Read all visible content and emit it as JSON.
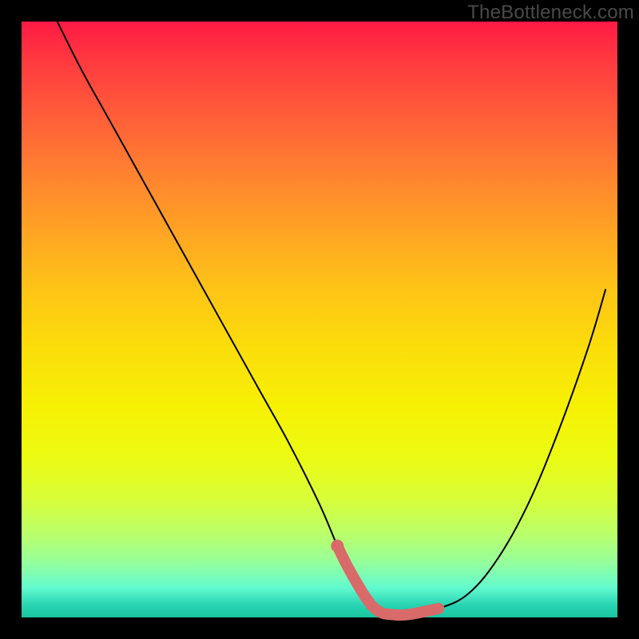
{
  "watermark": "TheBottleneck.com",
  "chart_data": {
    "type": "line",
    "title": "",
    "xlabel": "",
    "ylabel": "",
    "xlim": [
      0,
      100
    ],
    "ylim": [
      0,
      100
    ],
    "grid": false,
    "legend": false,
    "series": [
      {
        "name": "bottleneck-curve",
        "color": "#000000",
        "stroke_width": 2,
        "x": [
          6,
          10,
          15,
          20,
          25,
          30,
          35,
          40,
          45,
          50,
          53,
          55,
          58,
          60,
          62,
          65,
          70,
          75,
          80,
          85,
          90,
          95,
          98
        ],
        "values": [
          100,
          92,
          83,
          74,
          65,
          56,
          47,
          38,
          29,
          19,
          12,
          8,
          3,
          1,
          0.5,
          0.5,
          1.5,
          4,
          10,
          19,
          31,
          45,
          55
        ]
      },
      {
        "name": "optimal-zone",
        "color": "#d96a6a",
        "stroke_width": 14,
        "x": [
          53,
          55,
          58,
          60,
          62,
          65,
          70
        ],
        "values": [
          12,
          8,
          3,
          1,
          0.5,
          0.5,
          1.5
        ]
      }
    ],
    "markers": [
      {
        "name": "optimal-start-dot",
        "x": 53,
        "y": 12,
        "r": 8,
        "color": "#d96a6a"
      }
    ]
  }
}
